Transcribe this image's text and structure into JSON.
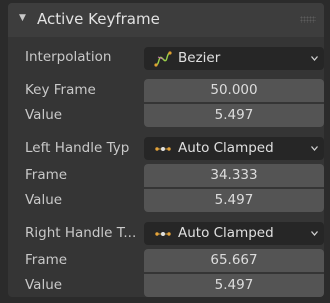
{
  "panel": {
    "title": "Active Keyframe",
    "interpolation": {
      "label": "Interpolation",
      "value": "Bezier",
      "icon": "bezier-curve-icon"
    },
    "key_frame": {
      "label": "Key Frame",
      "value": "50.000"
    },
    "value": {
      "label": "Value",
      "value": "5.497"
    },
    "left_handle": {
      "type_label": "Left Handle Typ",
      "type_value": "Auto Clamped",
      "icon": "auto-clamped-handle-icon",
      "frame_label": "Frame",
      "frame_value": "34.333",
      "value_label": "Value",
      "value_value": "5.497"
    },
    "right_handle": {
      "type_label": "Right Handle T...",
      "type_value": "Auto Clamped",
      "icon": "auto-clamped-handle-icon",
      "frame_label": "Frame",
      "frame_value": "65.667",
      "value_label": "Value",
      "value_value": "5.497"
    }
  }
}
